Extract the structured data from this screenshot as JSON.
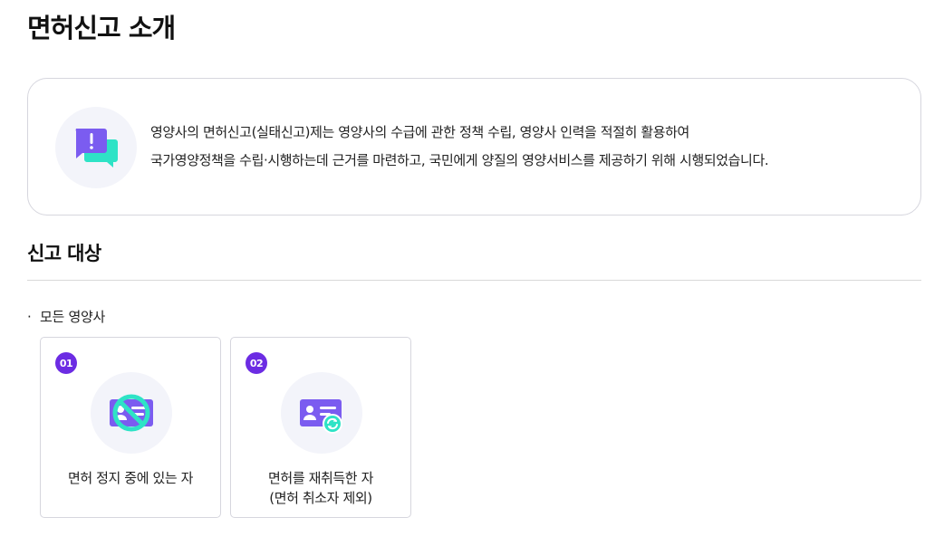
{
  "page": {
    "title": "면허신고 소개"
  },
  "intro": {
    "icon": "alert-chat-icon",
    "lines": [
      "영양사의 면허신고(실태신고)제는 영양사의 수급에 관한 정책 수립, 영양사 인력을 적절히 활용하여",
      "국가영양정책을 수립·시행하는데 근거를 마련하고, 국민에게 양질의 영양서비스를 제공하기 위해 시행되었습니다."
    ]
  },
  "target_section": {
    "title": "신고 대상",
    "bullet": "·",
    "subject": "모든 영양사",
    "cards": [
      {
        "number": "01",
        "icon": "license-suspended-icon",
        "label_lines": [
          "면허 정지 중에 있는 자"
        ]
      },
      {
        "number": "02",
        "icon": "license-reissued-icon",
        "label_lines": [
          "면허를 재취득한 자",
          "(면허 취소자 제외)"
        ]
      }
    ]
  },
  "colors": {
    "accent_purple": "#6c2ce3",
    "icon_purple": "#7b5cf0",
    "icon_mint": "#2ee3c6",
    "icon_bg": "#f3f4fa",
    "border": "#d6d6de"
  }
}
